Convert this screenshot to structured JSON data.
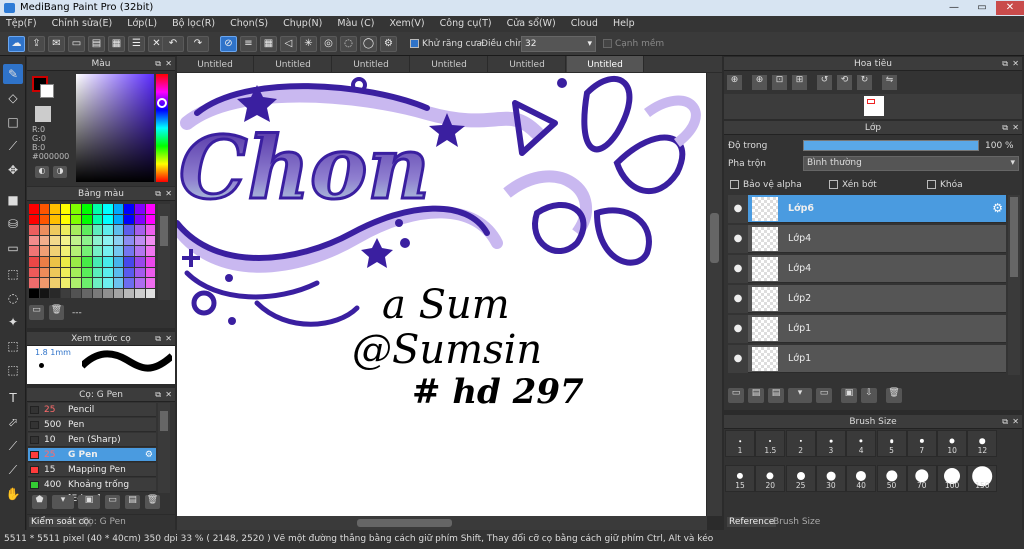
{
  "window": {
    "title": "MediBang Paint Pro (32bit)",
    "min": "—",
    "max": "▭",
    "close": "✕"
  },
  "menu": [
    "Tệp(F)",
    "Chỉnh sửa(E)",
    "Lớp(L)",
    "Bộ lọc(R)",
    "Chọn(S)",
    "Chụp(N)",
    "Màu (C)",
    "Xem(V)",
    "Công cụ(T)",
    "Cửa sổ(W)",
    "Cloud",
    "Help"
  ],
  "toolbar": {
    "antialias_label": "Khử răng cưa",
    "adjust_label": "Điều chỉnh",
    "adjust_value": "32",
    "edge_label": "Cạnh mềm"
  },
  "color_panel": {
    "title": "Màu",
    "r": "R:0",
    "g": "G:0",
    "b": "B:0",
    "hex": "#000000",
    "fg_color": "#000000",
    "bg_color": "#ffffff"
  },
  "palette_panel": {
    "title": "Bảng màu",
    "dash": "---"
  },
  "brush_preview": {
    "title": "Xem trước cọ",
    "size": "1.8 1mm"
  },
  "brush_panel": {
    "title": "Cọ: G Pen",
    "brushes": [
      {
        "size": "25",
        "name": "Pencil",
        "color": "#333333"
      },
      {
        "size": "500",
        "name": "Pen",
        "color": "#333333"
      },
      {
        "size": "10",
        "name": "Pen (Sharp)",
        "color": "#333333"
      },
      {
        "size": "25",
        "name": "G Pen",
        "color": "#ff3b3b"
      },
      {
        "size": "15",
        "name": "Mapping Pen",
        "color": "#ff3b3b"
      },
      {
        "size": "400",
        "name": "Khoảng trống [Edge ]",
        "color": "#33cc33"
      }
    ],
    "tab1": "Kiểm soát cọ",
    "tab2": "Cọ: G Pen"
  },
  "tabs": [
    "Untitled",
    "Untitled",
    "Untitled",
    "Untitled",
    "Untitled",
    "Untitled"
  ],
  "canvas_text": {
    "line1": "a Sum",
    "line2": "@Sumsin",
    "line3": "# hd 297"
  },
  "navigator": {
    "title": "Hoa tiêu"
  },
  "layer_panel": {
    "title": "Lớp",
    "opacity_label": "Độ trong",
    "opacity_value": "100 %",
    "opacity": 100,
    "blend_label": "Pha trộn",
    "blend_value": "Bình thường",
    "protect_alpha": "Bảo vệ alpha",
    "clipping": "Xén bớt",
    "lock": "Khóa",
    "layers": [
      "Lớp6",
      "Lớp4",
      "Lớp4",
      "Lớp2",
      "Lớp1",
      "Lớp1"
    ]
  },
  "brush_size": {
    "title": "Brush Size",
    "row1": [
      "1",
      "1.5",
      "2",
      "3",
      "4",
      "5",
      "7",
      "10",
      "12"
    ],
    "row2": [
      "15",
      "20",
      "25",
      "30",
      "40",
      "50",
      "70",
      "100",
      "150"
    ],
    "tab1": "Reference",
    "tab2": "Brush Size"
  },
  "status": {
    "text": "5511 * 5511 pixel  (40 * 40cm)   350 dpi   33 %   ( 2148, 2520 )   Vẽ một đường thẳng bằng cách giữ phím Shift, Thay đổi cỡ cọ bằng cách giữ phím Ctrl, Alt và kéo"
  }
}
